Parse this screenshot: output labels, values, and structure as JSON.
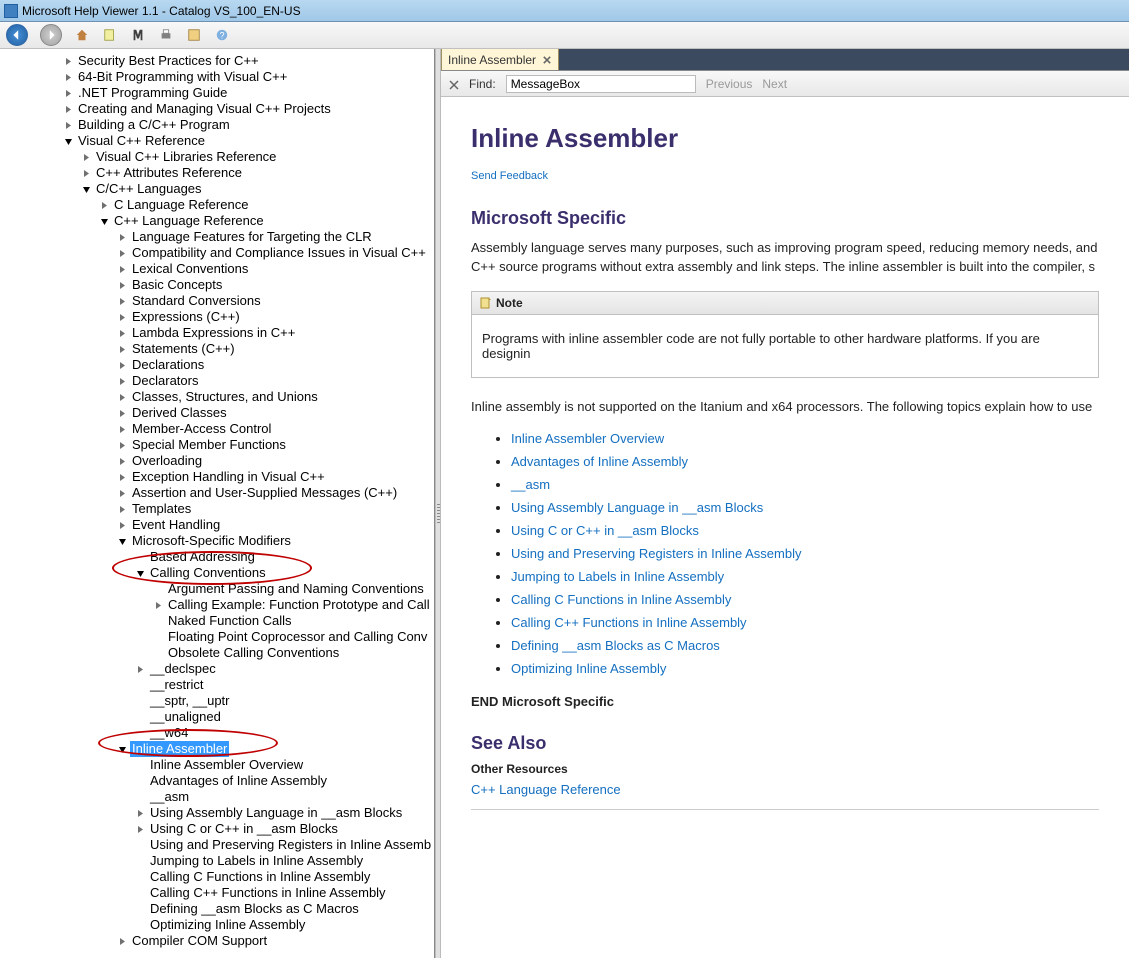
{
  "window": {
    "title": "Microsoft Help Viewer 1.1 - Catalog VS_100_EN-US"
  },
  "tab": {
    "label": "Inline Assembler"
  },
  "find": {
    "label": "Find:",
    "value": "MessageBox",
    "prev": "Previous",
    "next": "Next"
  },
  "tree": {
    "items": [
      {
        "depth": 0,
        "icon": "closed",
        "label": "Security Best Practices for C++"
      },
      {
        "depth": 0,
        "icon": "closed",
        "label": "64-Bit Programming with Visual C++"
      },
      {
        "depth": 0,
        "icon": "closed",
        "label": ".NET Programming Guide"
      },
      {
        "depth": 0,
        "icon": "closed",
        "label": "Creating and Managing Visual C++ Projects"
      },
      {
        "depth": 0,
        "icon": "closed",
        "label": "Building a C/C++ Program"
      },
      {
        "depth": 0,
        "icon": "open",
        "label": "Visual C++ Reference"
      },
      {
        "depth": 1,
        "icon": "closed",
        "label": "Visual C++ Libraries Reference"
      },
      {
        "depth": 1,
        "icon": "closed",
        "label": "C++ Attributes Reference"
      },
      {
        "depth": 1,
        "icon": "open",
        "label": "C/C++ Languages"
      },
      {
        "depth": 2,
        "icon": "closed",
        "label": "C Language Reference"
      },
      {
        "depth": 2,
        "icon": "open",
        "label": "C++ Language Reference"
      },
      {
        "depth": 3,
        "icon": "closed",
        "label": "Language Features for Targeting the CLR"
      },
      {
        "depth": 3,
        "icon": "closed",
        "label": "Compatibility and Compliance Issues in Visual C++"
      },
      {
        "depth": 3,
        "icon": "closed",
        "label": "Lexical Conventions"
      },
      {
        "depth": 3,
        "icon": "closed",
        "label": "Basic Concepts"
      },
      {
        "depth": 3,
        "icon": "closed",
        "label": "Standard Conversions"
      },
      {
        "depth": 3,
        "icon": "closed",
        "label": "Expressions (C++)"
      },
      {
        "depth": 3,
        "icon": "closed",
        "label": "Lambda Expressions in C++"
      },
      {
        "depth": 3,
        "icon": "closed",
        "label": "Statements (C++)"
      },
      {
        "depth": 3,
        "icon": "closed",
        "label": "Declarations"
      },
      {
        "depth": 3,
        "icon": "closed",
        "label": "Declarators"
      },
      {
        "depth": 3,
        "icon": "closed",
        "label": "Classes, Structures, and Unions"
      },
      {
        "depth": 3,
        "icon": "closed",
        "label": "Derived Classes"
      },
      {
        "depth": 3,
        "icon": "closed",
        "label": "Member-Access Control"
      },
      {
        "depth": 3,
        "icon": "closed",
        "label": "Special Member Functions"
      },
      {
        "depth": 3,
        "icon": "closed",
        "label": "Overloading"
      },
      {
        "depth": 3,
        "icon": "closed",
        "label": "Exception Handling in Visual C++"
      },
      {
        "depth": 3,
        "icon": "closed",
        "label": "Assertion and User-Supplied Messages (C++)"
      },
      {
        "depth": 3,
        "icon": "closed",
        "label": "Templates"
      },
      {
        "depth": 3,
        "icon": "closed",
        "label": "Event Handling"
      },
      {
        "depth": 3,
        "icon": "open",
        "label": "Microsoft-Specific Modifiers"
      },
      {
        "depth": 4,
        "icon": "none",
        "label": "Based Addressing"
      },
      {
        "depth": 4,
        "icon": "open",
        "label": "Calling Conventions"
      },
      {
        "depth": 5,
        "icon": "none",
        "label": "Argument Passing and Naming Conventions"
      },
      {
        "depth": 5,
        "icon": "closed",
        "label": "Calling Example: Function Prototype and Call"
      },
      {
        "depth": 5,
        "icon": "none",
        "label": "Naked Function Calls"
      },
      {
        "depth": 5,
        "icon": "none",
        "label": "Floating Point Coprocessor and Calling Conv"
      },
      {
        "depth": 5,
        "icon": "none",
        "label": "Obsolete Calling Conventions"
      },
      {
        "depth": 4,
        "icon": "closed",
        "label": "__declspec"
      },
      {
        "depth": 4,
        "icon": "none",
        "label": "__restrict"
      },
      {
        "depth": 4,
        "icon": "none",
        "label": "__sptr, __uptr"
      },
      {
        "depth": 4,
        "icon": "none",
        "label": "__unaligned"
      },
      {
        "depth": 4,
        "icon": "none",
        "label": "__w64"
      },
      {
        "depth": 3,
        "icon": "open",
        "label": "Inline Assembler",
        "selected": true
      },
      {
        "depth": 4,
        "icon": "none",
        "label": "Inline Assembler Overview"
      },
      {
        "depth": 4,
        "icon": "none",
        "label": "Advantages of Inline Assembly"
      },
      {
        "depth": 4,
        "icon": "none",
        "label": "__asm"
      },
      {
        "depth": 4,
        "icon": "closed",
        "label": "Using Assembly Language in __asm Blocks"
      },
      {
        "depth": 4,
        "icon": "closed",
        "label": "Using C or C++ in __asm Blocks"
      },
      {
        "depth": 4,
        "icon": "none",
        "label": "Using and Preserving Registers in Inline Assemb"
      },
      {
        "depth": 4,
        "icon": "none",
        "label": "Jumping to Labels in Inline Assembly"
      },
      {
        "depth": 4,
        "icon": "none",
        "label": "Calling C Functions in Inline Assembly"
      },
      {
        "depth": 4,
        "icon": "none",
        "label": "Calling C++ Functions in Inline Assembly"
      },
      {
        "depth": 4,
        "icon": "none",
        "label": "Defining __asm Blocks as C Macros"
      },
      {
        "depth": 4,
        "icon": "none",
        "label": "Optimizing Inline Assembly"
      },
      {
        "depth": 3,
        "icon": "closed",
        "label": "Compiler COM Support"
      }
    ]
  },
  "article": {
    "title": "Inline Assembler",
    "feedback": "Send Feedback",
    "section1": "Microsoft Specific",
    "para1": "Assembly language serves many purposes, such as improving program speed, reducing memory needs, and C++ source programs without extra assembly and link steps. The inline assembler is built into the compiler, s",
    "note_head": "Note",
    "note_body": "Programs with inline assembler code are not fully portable to other hardware platforms. If you are designin",
    "para2": "Inline assembly is not supported on the Itanium and x64 processors. The following topics explain how to use",
    "links": [
      "Inline Assembler Overview",
      "Advantages of Inline Assembly",
      "__asm",
      "Using Assembly Language in __asm Blocks",
      "Using C or C++ in __asm Blocks",
      "Using and Preserving Registers in Inline Assembly",
      "Jumping to Labels in Inline Assembly",
      "Calling C Functions in Inline Assembly",
      "Calling C++ Functions in Inline Assembly",
      "Defining __asm Blocks as C Macros",
      "Optimizing Inline Assembly"
    ],
    "end_label": "END Microsoft Specific",
    "seealso": "See Also",
    "other_res": "Other Resources",
    "seealso_link": "C++ Language Reference"
  }
}
